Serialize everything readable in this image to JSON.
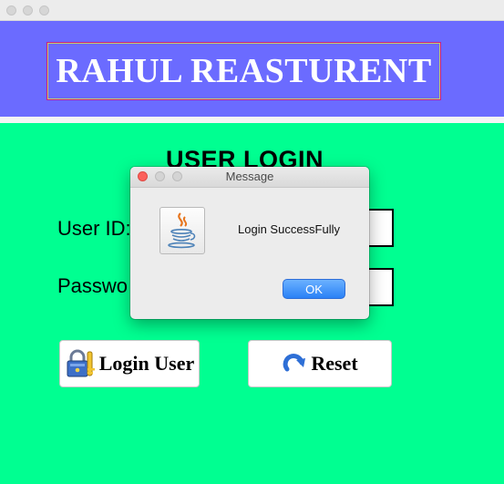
{
  "window": {
    "title_dots": [
      "close",
      "minimize",
      "zoom"
    ]
  },
  "header": {
    "title": "RAHUL REASTURENT"
  },
  "login": {
    "heading": "USER LOGIN",
    "user_id_label": "User ID:",
    "password_label": "Passwo",
    "login_button_label": "Login User",
    "reset_button_label": "Reset"
  },
  "dialog": {
    "title": "Message",
    "message": "Login SuccessFully",
    "ok_label": "OK",
    "icon": "java-coffee-cup-icon"
  },
  "colors": {
    "header_bg": "#6b6bff",
    "main_bg": "#00ff91",
    "ok_button": "#2a81f6"
  }
}
